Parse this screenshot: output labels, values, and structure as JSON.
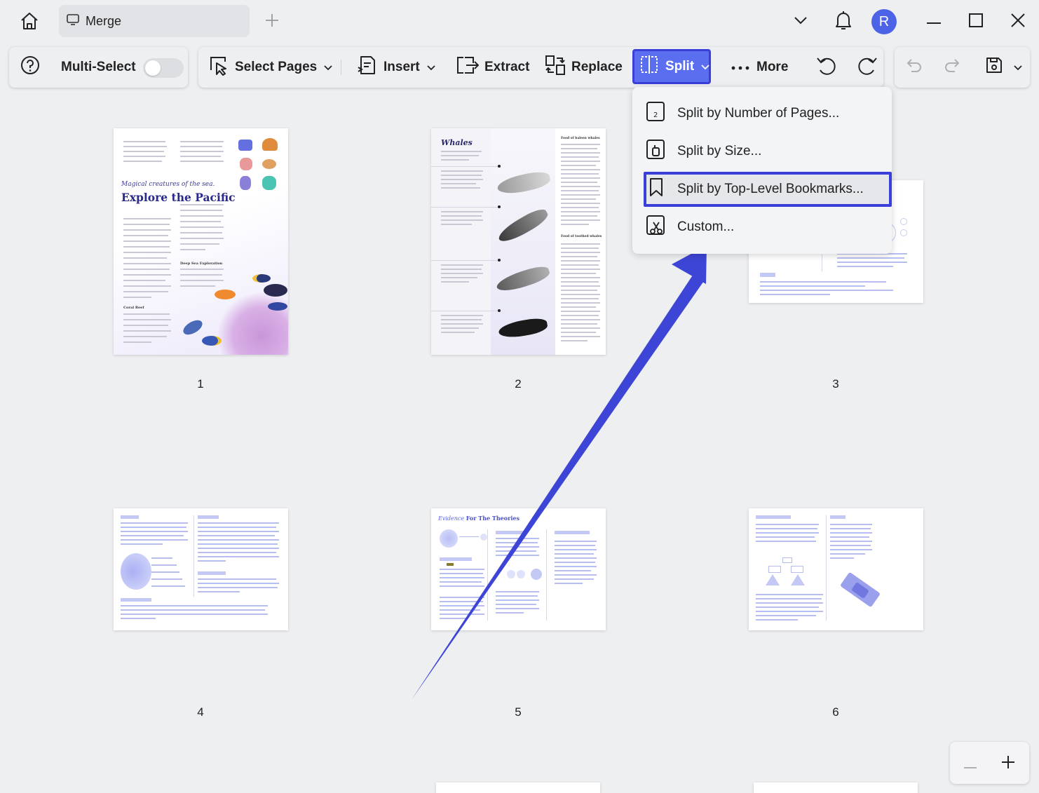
{
  "window": {
    "tab_title": "Merge",
    "avatar_letter": "R"
  },
  "toolbar": {
    "multi_select_label": "Multi-Select",
    "multi_select_on": false,
    "select_pages_label": "Select Pages",
    "insert_label": "Insert",
    "extract_label": "Extract",
    "replace_label": "Replace",
    "split_label": "Split",
    "more_label": "More"
  },
  "split_menu": {
    "items": [
      {
        "label": "Split by Number of Pages...",
        "icon": "page-number-icon"
      },
      {
        "label": "Split by Size...",
        "icon": "size-icon"
      },
      {
        "label": "Split by Top-Level Bookmarks...",
        "icon": "bookmark-icon",
        "highlighted": true
      },
      {
        "label": "Custom...",
        "icon": "scissors-icon"
      }
    ]
  },
  "pages": [
    {
      "number": "1",
      "title_italic": "Magical creatures of the sea.",
      "title": "Explore the Pacific",
      "sub1": "Deep Sea Exploration",
      "sub2": "Coral Reef"
    },
    {
      "number": "2",
      "title": "Whales",
      "sub1": "Food of baleen whales",
      "sub2": "Food of toothed whales"
    },
    {
      "number": "3"
    },
    {
      "number": "4"
    },
    {
      "number": "5",
      "title_italic": "Evidence",
      "title": "For The Theories"
    },
    {
      "number": "6"
    }
  ],
  "colors": {
    "accent": "#5b6ef0",
    "highlight_border": "#3a3fd9",
    "arrow": "#3d45d6",
    "avatar": "#4c63e8"
  }
}
